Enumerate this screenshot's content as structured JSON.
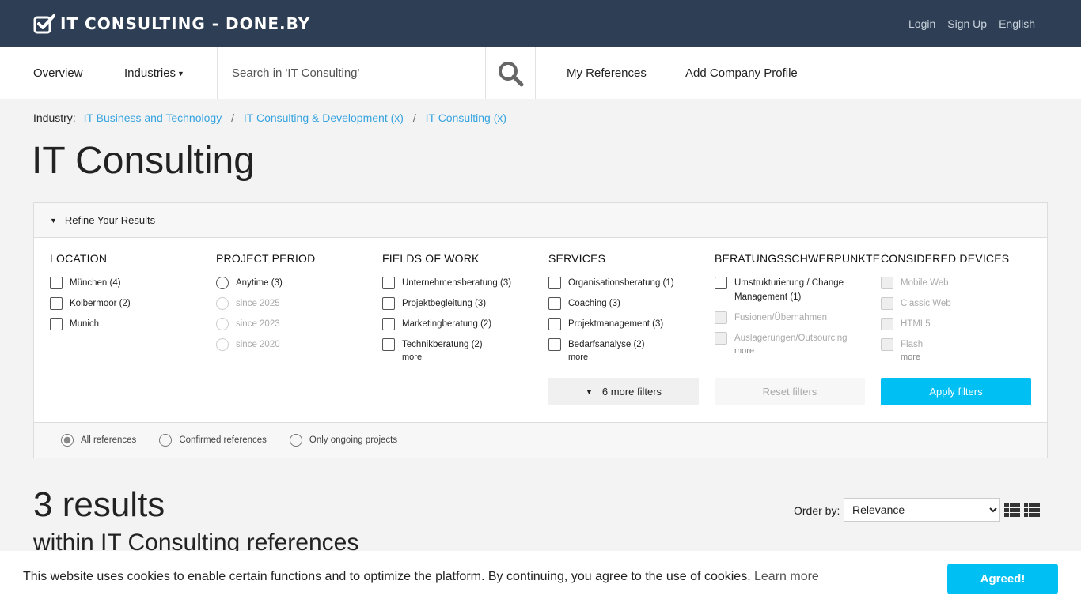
{
  "header": {
    "brand": "IT CONSULTING - DONE.BY",
    "links": [
      "Login",
      "Sign Up",
      "English"
    ]
  },
  "nav": {
    "overview": "Overview",
    "industries": "Industries",
    "search_placeholder": "Search in 'IT Consulting'",
    "my_references": "My References",
    "add_company_profile": "Add Company Profile"
  },
  "breadcrumb": {
    "label": "Industry:",
    "items": [
      "IT Business and Technology",
      "IT Consulting & Development (x)",
      "IT Consulting (x)"
    ],
    "separator": "/"
  },
  "page_title": "IT Consulting",
  "filters": {
    "header": "Refine Your Results",
    "location": {
      "title": "LOCATION",
      "options": [
        "München (4)",
        "Kolbermoor (2)",
        "Munich"
      ]
    },
    "project_period": {
      "title": "PROJECT PERIOD",
      "options": [
        "Anytime (3)",
        "since 2025",
        "since 2023",
        "since 2020"
      ]
    },
    "fields_of_work": {
      "title": "FIELDS OF WORK",
      "options": [
        "Unternehmensberatung (3)",
        "Projektbegleitung (3)",
        "Marketingberatung (2)",
        "Technikberatung (2)"
      ],
      "more": "more"
    },
    "services": {
      "title": "SERVICES",
      "options": [
        "Organisationsberatung (1)",
        "Coaching (3)",
        "Projektmanagement (3)",
        "Bedarfsanalyse (2)"
      ],
      "more": "more"
    },
    "beratung": {
      "title": "BERATUNGSSCHWERPUNKTE",
      "options": [
        "Umstrukturierung / Change Management (1)",
        "Fusionen/Übernahmen",
        "Auslagerungen/Outsourcing"
      ],
      "more": "more"
    },
    "devices": {
      "title": "CONSIDERED DEVICES",
      "options": [
        "Mobile Web",
        "Classic Web",
        "HTML5",
        "Flash"
      ],
      "more": "more"
    },
    "more_filters": "6 more filters",
    "reset": "Reset filters",
    "apply": "Apply filters",
    "reference_types": [
      "All references",
      "Confirmed references",
      "Only ongoing projects"
    ]
  },
  "results": {
    "count": "3 results",
    "subtitle": "within IT Consulting references",
    "order_label": "Order by:",
    "order_value": "Relevance"
  },
  "cookie": {
    "text": "This website uses cookies to enable certain functions and to optimize the platform. By continuing, you agree to the use of cookies.",
    "link": "Learn more",
    "button": "Agreed!"
  },
  "colors": {
    "header_bg": "#2e3f55",
    "accent": "#00bff3",
    "link": "#37a4e0"
  }
}
